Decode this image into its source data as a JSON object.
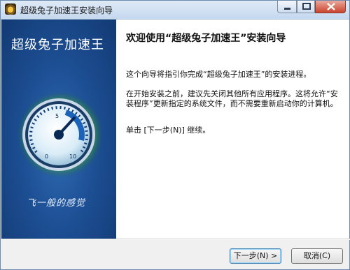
{
  "window": {
    "title": "超级兔子加速王安装向导"
  },
  "sidebar": {
    "brand": "超级兔子加速王",
    "slogan": "飞一般的感觉",
    "gauge_labels": [
      "0",
      "5",
      "10"
    ]
  },
  "content": {
    "heading": "欢迎使用“超级兔子加速王”安装向导",
    "paragraphs": [
      "这个向导将指引你完成“超级兔子加速王”的安装进程。",
      "在开始安装之前，建议先关闭其他所有应用程序。这将允许“安装程序”更新指定的系统文件，而不需要重新启动你的计算机。",
      "单击 [下一步(N)] 继续。"
    ]
  },
  "buttons": {
    "next": "下一步(N) >",
    "cancel": "取消(C)"
  }
}
